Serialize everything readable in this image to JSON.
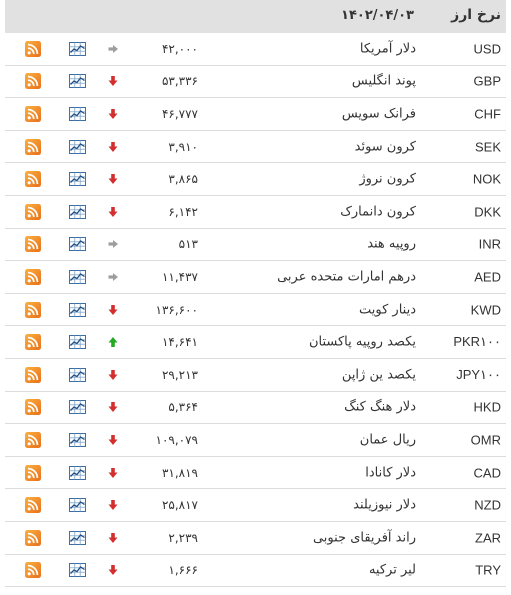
{
  "header": {
    "title": "نرخ ارز",
    "date": "۱۴۰۲/۰۴/۰۳"
  },
  "colors": {
    "header_bg": "#e1e1e1",
    "down": "#d32f2f",
    "up": "#22aa22",
    "unchanged": "#9e9e9e",
    "rss": "#f7931e",
    "chart": "#2f6aa3"
  },
  "rows": [
    {
      "code": "USD",
      "name": "دلار آمریکا",
      "value": "۴۲,۰۰۰",
      "trend": "unchanged"
    },
    {
      "code": "GBP",
      "name": "پوند انگلیس",
      "value": "۵۳,۳۳۶",
      "trend": "down"
    },
    {
      "code": "CHF",
      "name": "فرانک سویس",
      "value": "۴۶,۷۷۷",
      "trend": "down"
    },
    {
      "code": "SEK",
      "name": "کرون سوئد",
      "value": "۳,۹۱۰",
      "trend": "down"
    },
    {
      "code": "NOK",
      "name": "کرون نروژ",
      "value": "۳,۸۶۵",
      "trend": "down"
    },
    {
      "code": "DKK",
      "name": "کرون دانمارک",
      "value": "۶,۱۴۲",
      "trend": "down"
    },
    {
      "code": "INR",
      "name": "روپیه هند",
      "value": "۵۱۳",
      "trend": "unchanged"
    },
    {
      "code": "AED",
      "name": "درهم امارات متحده عربی",
      "value": "۱۱,۴۳۷",
      "trend": "unchanged"
    },
    {
      "code": "KWD",
      "name": "دینار کویت",
      "value": "۱۳۶,۶۰۰",
      "trend": "down"
    },
    {
      "code": "PKR۱۰۰",
      "name": "یکصد روپیه پاکستان",
      "value": "۱۴,۶۴۱",
      "trend": "up"
    },
    {
      "code": "JPY۱۰۰",
      "name": "یکصد ین ژاپن",
      "value": "۲۹,۲۱۳",
      "trend": "down"
    },
    {
      "code": "HKD",
      "name": "دلار هنگ کنگ",
      "value": "۵,۳۶۴",
      "trend": "down"
    },
    {
      "code": "OMR",
      "name": "ریال عمان",
      "value": "۱۰۹,۰۷۹",
      "trend": "down"
    },
    {
      "code": "CAD",
      "name": "دلار کانادا",
      "value": "۳۱,۸۱۹",
      "trend": "down"
    },
    {
      "code": "NZD",
      "name": "دلار نیوزیلند",
      "value": "۲۵,۸۱۷",
      "trend": "down"
    },
    {
      "code": "ZAR",
      "name": "راند آفریقای جنوبی",
      "value": "۲,۲۳۹",
      "trend": "down"
    },
    {
      "code": "TRY",
      "name": "لیر ترکیه",
      "value": "۱,۶۶۶",
      "trend": "down"
    }
  ],
  "icons": {
    "rss": "rss-feed-icon",
    "chart": "line-chart-icon",
    "arrow_down": "arrow-down-icon",
    "arrow_up": "arrow-up-icon",
    "arrow_right": "arrow-right-icon"
  }
}
